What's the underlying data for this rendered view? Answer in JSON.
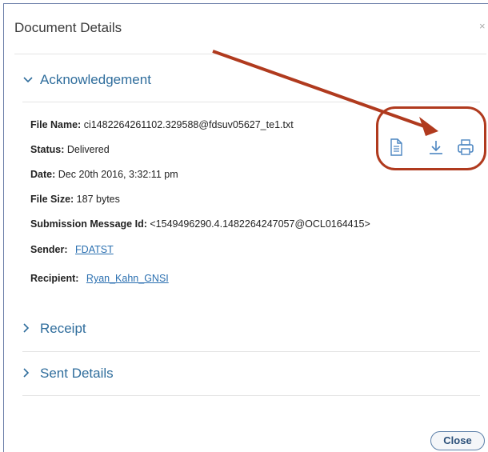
{
  "dialog": {
    "title": "Document Details",
    "close_icon": "×",
    "close_button_label": "Close"
  },
  "sections": {
    "acknowledgement": {
      "label": "Acknowledgement",
      "expanded": true
    },
    "receipt": {
      "label": "Receipt",
      "expanded": false
    },
    "sent_details": {
      "label": "Sent Details",
      "expanded": false
    }
  },
  "fields": {
    "file_name": {
      "label": "File Name:",
      "value": "ci1482264261102.329588@fdsuv05627_te1.txt"
    },
    "status": {
      "label": "Status:",
      "value": "Delivered"
    },
    "date": {
      "label": "Date:",
      "value": "Dec 20th 2016, 3:32:11 pm"
    },
    "file_size": {
      "label": "File Size:",
      "value": "187 bytes"
    },
    "submission_message_id": {
      "label": "Submission Message Id:",
      "value": "<1549496290.4.1482264247057@OCL0164415>"
    },
    "sender": {
      "label": "Sender:",
      "value": "FDATST"
    },
    "recipient": {
      "label": "Recipient:",
      "value": "Ryan_Kahn_GNSI"
    }
  },
  "actions": {
    "icons": [
      "document-icon",
      "download-icon",
      "print-icon"
    ]
  },
  "colors": {
    "accent": "#2f6d9c",
    "link": "#2a6fb0",
    "annotation": "#b03a1e"
  }
}
